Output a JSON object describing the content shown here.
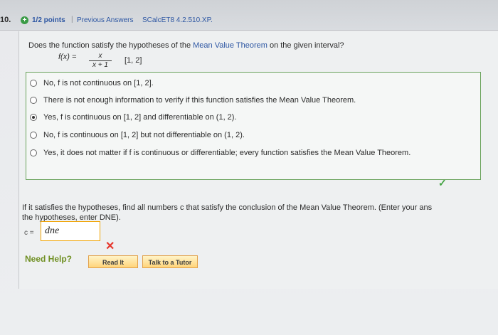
{
  "header": {
    "question_number": "10.",
    "points": "1/2 points",
    "separator": "|",
    "previous_answers": "Previous Answers",
    "question_code": "SCalcET8 4.2.510.XP."
  },
  "question": {
    "prompt_start": "Does the function satisfy the hypotheses of the ",
    "prompt_link": "Mean Value Theorem",
    "prompt_end": " on the given interval?",
    "function_label": "f(x) =",
    "numerator": "x",
    "denominator": "x + 1",
    "interval": "[1, 2]"
  },
  "options": [
    {
      "text": "No, f is not continuous on [1, 2].",
      "selected": false
    },
    {
      "text": "There is not enough information to verify if this function satisfies the Mean Value Theorem.",
      "selected": false
    },
    {
      "text": "Yes, f is continuous on [1, 2] and differentiable on (1, 2).",
      "selected": true
    },
    {
      "text": "No, f is continuous on [1, 2] but not differentiable on (1, 2).",
      "selected": false
    },
    {
      "text": "Yes, it does not matter if f is continuous or differentiable; every function satisfies the Mean Value Theorem.",
      "selected": false
    }
  ],
  "followup": {
    "line1": "If it satisfies the hypotheses, find all numbers c that satisfy the conclusion of the Mean Value Theorem. (Enter your ans",
    "line2": "the hypotheses, enter DNE).",
    "c_label": "c =",
    "c_value": "dne"
  },
  "help": {
    "label": "Need Help?",
    "read_it": "Read It",
    "talk_tutor": "Talk to a Tutor"
  },
  "status_icons": {
    "correct": "check-icon",
    "incorrect": "x-icon"
  },
  "colors": {
    "link_blue": "#2e57a3",
    "correct_green": "#44a443",
    "incorrect_red": "#e6392f",
    "help_green": "#6f8f22"
  }
}
